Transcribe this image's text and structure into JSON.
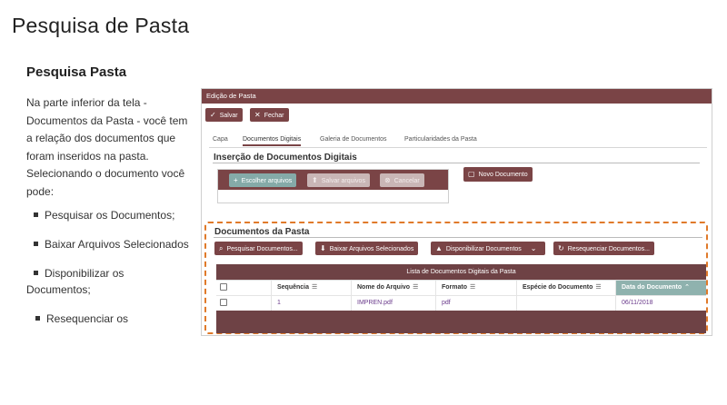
{
  "page": {
    "title": "Pesquisa de Pasta",
    "section_title": "Pesquisa Pasta",
    "intro_lines": [
      "Na parte inferior da tela -",
      "Documentos da Pasta -  você tem",
      "a relação dos documentos que",
      "foram inseridos na pasta.",
      "Selecionando o documento você",
      "pode:"
    ],
    "bullets": [
      "Pesquisar os Documentos;",
      "Baixar Arquivos Selecionados",
      "Disponibilizar os",
      "Documentos;",
      "Resequenciar os"
    ]
  },
  "screenshot": {
    "header": "Edição de Pasta",
    "toolbar": {
      "save": "Salvar",
      "close": "Fechar"
    },
    "tabs": [
      "Capa",
      "Documentos Digitais",
      "Galeria de Documentos",
      "Particularidades da Pasta"
    ],
    "insercao_title": "Inserção de Documentos Digitais",
    "upload": {
      "choose": "Escolher arquivos",
      "save": "Salvar arquivos",
      "cancel": "Cancelar"
    },
    "novo_documento": "Novo Documento",
    "docs_title": "Documentos da Pasta",
    "actions": {
      "search": "Pesquisar Documentos...",
      "download": "Baixar Arquivos Selecionados",
      "publish": "Disponibilizar Documentos",
      "resequence": "Resequenciar Documentos..."
    },
    "grid": {
      "title": "Lista de Documentos Digitais da Pasta",
      "columns": [
        "Sequência",
        "Nome do Arquivo",
        "Formato",
        "Espécie do Documento",
        "Data do Documento"
      ],
      "rows": [
        {
          "sequencia": "1",
          "nome": "IMPREN.pdf",
          "formato": "pdf",
          "especie": "",
          "data": "06/11/2018"
        }
      ]
    },
    "colors": {
      "primary": "#7a4446",
      "highlight": "#e07a2a",
      "sorted_col": "#8fb2ae"
    }
  }
}
